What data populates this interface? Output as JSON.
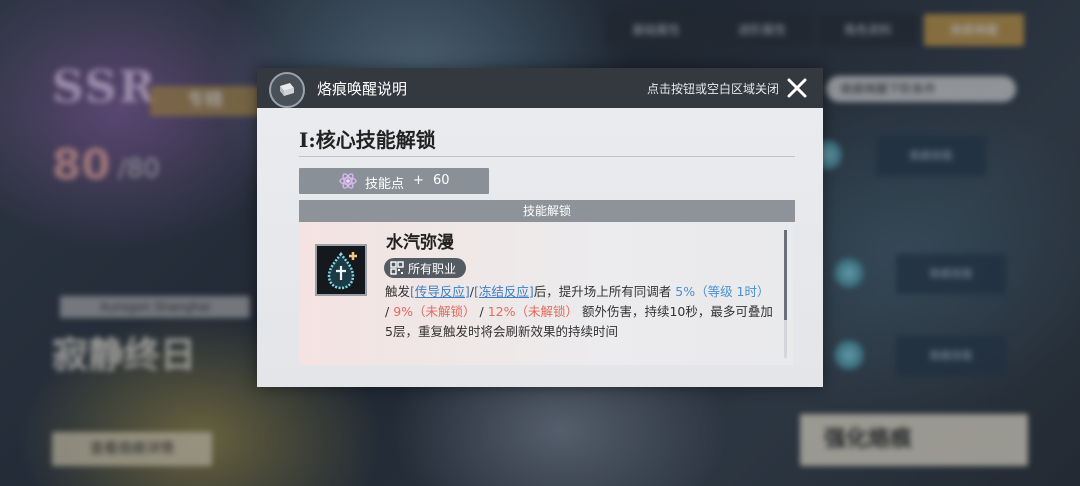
{
  "background": {
    "rarity": "SSR",
    "tag": "专精",
    "level": "80",
    "level_max": "80",
    "name_plate": "Aurogon Shanghai",
    "char_name": "寂静终日",
    "tabs": [
      {
        "label": "基础属性"
      },
      {
        "label": "进阶属性"
      },
      {
        "label": "角色资料"
      },
      {
        "label": "烙痕唤醒"
      }
    ],
    "right_pill": "烙痕唤醒下阶条件",
    "nodes": [
      {
        "label": "烙痕技能"
      },
      {
        "label": "烙痕技能"
      },
      {
        "label": "烙痕技能"
      }
    ],
    "bottom_button": "查看烙痕详情",
    "enhance_button": "强化烙痕"
  },
  "dialog": {
    "title": "烙痕唤醒说明",
    "close_hint": "点击按钮或空白区域关闭",
    "section_title": "I:核心技能解锁",
    "skill_points": {
      "label": "技能点",
      "plus": "+",
      "value": "60"
    },
    "unlock_header": "技能解锁",
    "skill": {
      "name": "水汽弥漫",
      "class_tag": "所有职业",
      "desc": {
        "p1": "触发",
        "link1": "[传导反应]",
        "slash": "/",
        "link2": "[冻结反应]",
        "p2": "后，提升场上所有同调者 ",
        "v1": "5%（等级 1时）",
        "sep1": " / ",
        "v2": "9%（未解锁）",
        "sep2": " / ",
        "v3": "12%（未解锁）",
        "p3": " 额外伤害，持续10秒，最多可叠加5层，重复触发时将会刷新效果的持续时间"
      }
    }
  },
  "colors": {
    "header_bg": "#34383f",
    "link": "#3a7fc4",
    "value_active": "#4a90d0",
    "value_locked": "#e06a5e"
  }
}
